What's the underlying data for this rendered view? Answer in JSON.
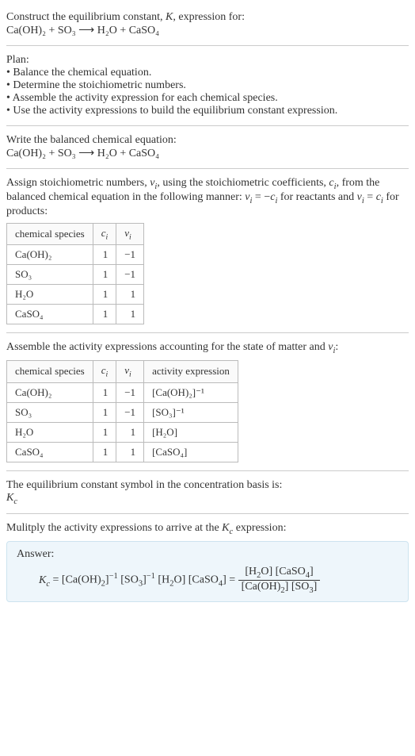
{
  "header": {
    "line1": "Construct the equilibrium constant, K, expression for:",
    "equation": "Ca(OH)₂ + SO₃ ⟶ H₂O + CaSO₄"
  },
  "plan": {
    "title": "Plan:",
    "steps": [
      "• Balance the chemical equation.",
      "• Determine the stoichiometric numbers.",
      "• Assemble the activity expression for each chemical species.",
      "• Use the activity expressions to build the equilibrium constant expression."
    ]
  },
  "balanced": {
    "intro": "Write the balanced chemical equation:",
    "equation": "Ca(OH)₂ + SO₃ ⟶ H₂O + CaSO₄"
  },
  "stoich": {
    "intro_a": "Assign stoichiometric numbers, νᵢ, using the stoichiometric coefficients, cᵢ, from the balanced chemical equation in the following manner: νᵢ = −cᵢ for reactants and νᵢ = cᵢ for products:",
    "headers": [
      "chemical species",
      "cᵢ",
      "νᵢ"
    ],
    "rows": [
      {
        "species": "Ca(OH)₂",
        "c": "1",
        "v": "−1"
      },
      {
        "species": "SO₃",
        "c": "1",
        "v": "−1"
      },
      {
        "species": "H₂O",
        "c": "1",
        "v": "1"
      },
      {
        "species": "CaSO₄",
        "c": "1",
        "v": "1"
      }
    ]
  },
  "activity": {
    "intro": "Assemble the activity expressions accounting for the state of matter and νᵢ:",
    "headers": [
      "chemical species",
      "cᵢ",
      "νᵢ",
      "activity expression"
    ],
    "rows": [
      {
        "species": "Ca(OH)₂",
        "c": "1",
        "v": "−1",
        "expr": "[Ca(OH)₂]⁻¹"
      },
      {
        "species": "SO₃",
        "c": "1",
        "v": "−1",
        "expr": "[SO₃]⁻¹"
      },
      {
        "species": "H₂O",
        "c": "1",
        "v": "1",
        "expr": "[H₂O]"
      },
      {
        "species": "CaSO₄",
        "c": "1",
        "v": "1",
        "expr": "[CaSO₄]"
      }
    ]
  },
  "symbol": {
    "line1": "The equilibrium constant symbol in the concentration basis is:",
    "line2": "K꜀"
  },
  "multiply": {
    "intro": "Mulitply the activity expressions to arrive at the K꜀ expression:"
  },
  "answer": {
    "label": "Answer:",
    "lhs": "K꜀ = [Ca(OH)₂]⁻¹ [SO₃]⁻¹ [H₂O] [CaSO₄] = ",
    "frac_num": "[H₂O] [CaSO₄]",
    "frac_den": "[Ca(OH)₂] [SO₃]"
  }
}
